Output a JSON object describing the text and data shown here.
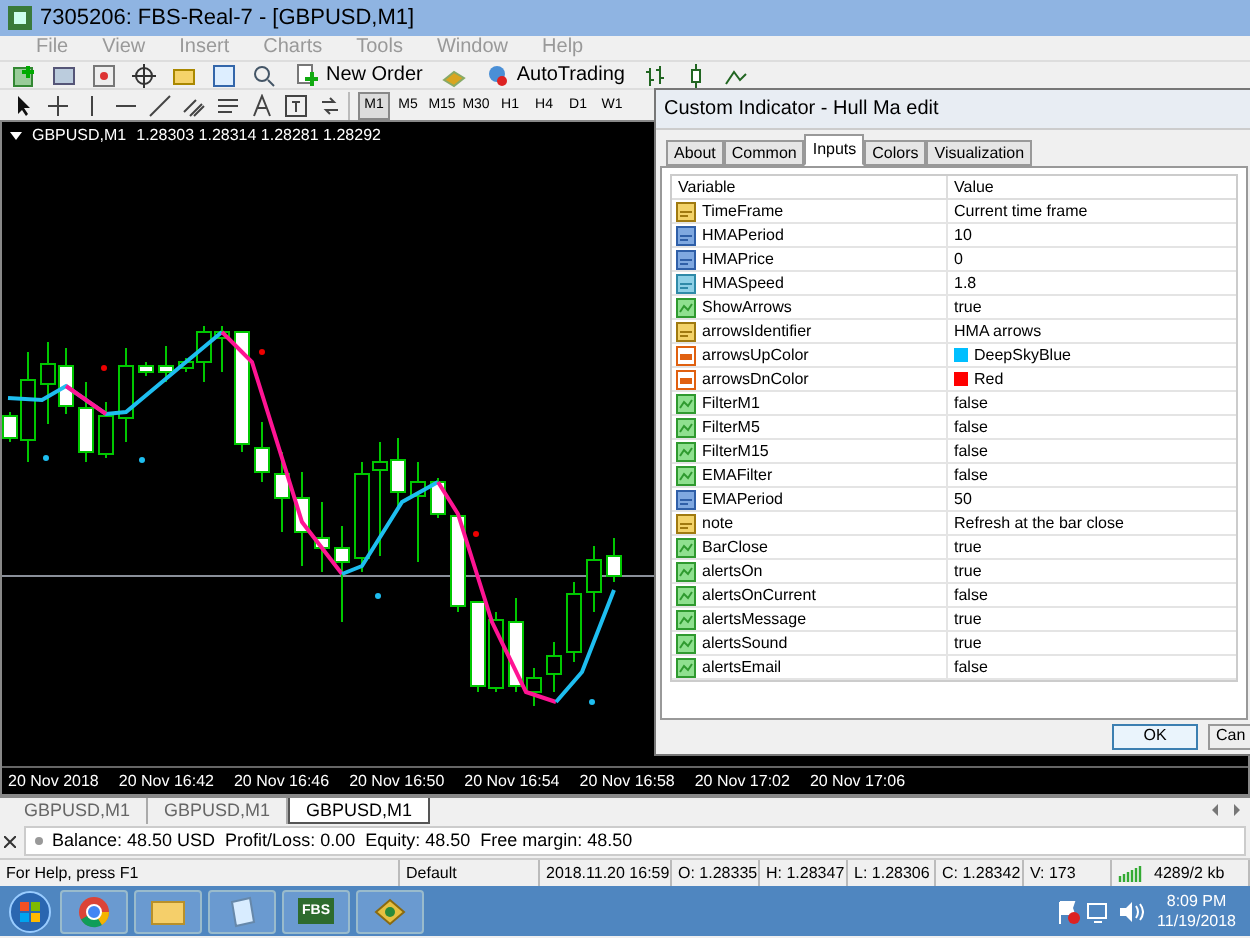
{
  "window": {
    "title": "7305206: FBS-Real-7 - [GBPUSD,M1]"
  },
  "menu": [
    "File",
    "View",
    "Insert",
    "Charts",
    "Tools",
    "Window",
    "Help"
  ],
  "toolbar": {
    "buttons": [
      "New Order",
      "AutoTrading"
    ]
  },
  "timeframes": [
    {
      "label": "M1",
      "selected": true
    },
    {
      "label": "M5",
      "selected": false
    },
    {
      "label": "M15",
      "selected": false
    },
    {
      "label": "M30",
      "selected": false
    },
    {
      "label": "H1",
      "selected": false
    },
    {
      "label": "H4",
      "selected": false
    },
    {
      "label": "D1",
      "selected": false
    },
    {
      "label": "W1",
      "selected": false
    }
  ],
  "chart": {
    "symbol": "GBPUSD,M1",
    "quote": "1.28303 1.28314 1.28281 1.28292",
    "time_labels": [
      "20 Nov 2018",
      "20 Nov 16:42",
      "20 Nov 16:46",
      "20 Nov 16:50",
      "20 Nov 16:54",
      "20 Nov 16:58",
      "20 Nov 17:02",
      "20 Nov 17:06"
    ]
  },
  "dialog": {
    "title": "Custom Indicator - Hull Ma edit",
    "tabs": [
      {
        "label": "About",
        "selected": false
      },
      {
        "label": "Common",
        "selected": false
      },
      {
        "label": "Inputs",
        "selected": true
      },
      {
        "label": "Colors",
        "selected": false
      },
      {
        "label": "Visualization",
        "selected": false
      }
    ],
    "columns": [
      "Variable",
      "Value"
    ],
    "rows": [
      {
        "kind": "string",
        "name": "TimeFrame",
        "value": "Current time frame"
      },
      {
        "kind": "int",
        "name": "HMAPeriod",
        "value": "10"
      },
      {
        "kind": "int",
        "name": "HMAPrice",
        "value": "0"
      },
      {
        "kind": "double",
        "name": "HMASpeed",
        "value": "1.8"
      },
      {
        "kind": "bool",
        "name": "ShowArrows",
        "value": "true"
      },
      {
        "kind": "string",
        "name": "arrowsIdentifier",
        "value": "HMA arrows"
      },
      {
        "kind": "color",
        "name": "arrowsUpColor",
        "value": "DeepSkyBlue",
        "color": "#00bfff"
      },
      {
        "kind": "color",
        "name": "arrowsDnColor",
        "value": "Red",
        "color": "#ff0000"
      },
      {
        "kind": "bool",
        "name": "FilterM1",
        "value": "false"
      },
      {
        "kind": "bool",
        "name": "FilterM5",
        "value": "false"
      },
      {
        "kind": "bool",
        "name": "FilterM15",
        "value": "false"
      },
      {
        "kind": "bool",
        "name": "EMAFilter",
        "value": "false"
      },
      {
        "kind": "int",
        "name": "EMAPeriod",
        "value": "50"
      },
      {
        "kind": "string",
        "name": "note",
        "value": "Refresh at the bar close"
      },
      {
        "kind": "bool",
        "name": "BarClose",
        "value": "true"
      },
      {
        "kind": "bool",
        "name": "alertsOn",
        "value": "true"
      },
      {
        "kind": "bool",
        "name": "alertsOnCurrent",
        "value": "false"
      },
      {
        "kind": "bool",
        "name": "alertsMessage",
        "value": "true"
      },
      {
        "kind": "bool",
        "name": "alertsSound",
        "value": "true"
      },
      {
        "kind": "bool",
        "name": "alertsEmail",
        "value": "false"
      }
    ],
    "buttons": [
      "OK",
      "Can"
    ]
  },
  "chart_tabs": [
    {
      "label": "GBPUSD,M1",
      "selected": false
    },
    {
      "label": "GBPUSD,M1",
      "selected": false
    },
    {
      "label": "GBPUSD,M1",
      "selected": true
    }
  ],
  "terminal": {
    "balance": "Balance: 48.50 USD  Profit/Loss: 0.00  Equity: 48.50  Free margin: 48.50"
  },
  "status_bar": [
    "For Help, press F1",
    "Default",
    "2018.11.20 16:59",
    "O: 1.28335",
    "H: 1.28347",
    "L: 1.28306",
    "C: 1.28342",
    "V: 173",
    "4289/2 kb"
  ],
  "taskbar": {
    "fbs_label": "FBS",
    "time": "8:09 PM",
    "date": "11/19/2018"
  }
}
